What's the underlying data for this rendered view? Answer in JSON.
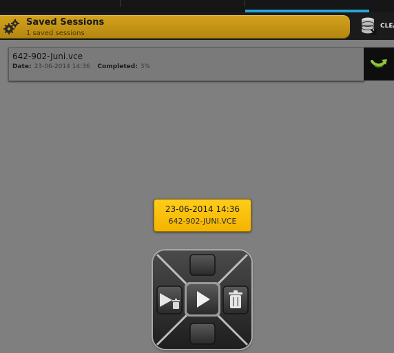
{
  "header": {
    "title": "Saved Sessions",
    "subtitle": "1 saved sessions",
    "clear_label": "CLEA",
    "icons": {
      "settings": "gears-icon",
      "clear": "database-delete-icon"
    },
    "accent_color": "#c99a17"
  },
  "sessions": [
    {
      "name": "642-902-Juni.vce",
      "date_label": "Date:",
      "date_value": "23-06-2014  14:36",
      "completed_label": "Completed:",
      "completed_value": "3%",
      "open_icon": "reload-icon"
    }
  ],
  "tooltip": {
    "date": "23-06-2014 14:36",
    "file": "642-902-JUNI.VCE",
    "color": "#f6b800"
  },
  "control_pad": {
    "center_icon": "play-icon",
    "left_icon": "play-and-delete-icon",
    "right_icon": "trash-icon"
  }
}
